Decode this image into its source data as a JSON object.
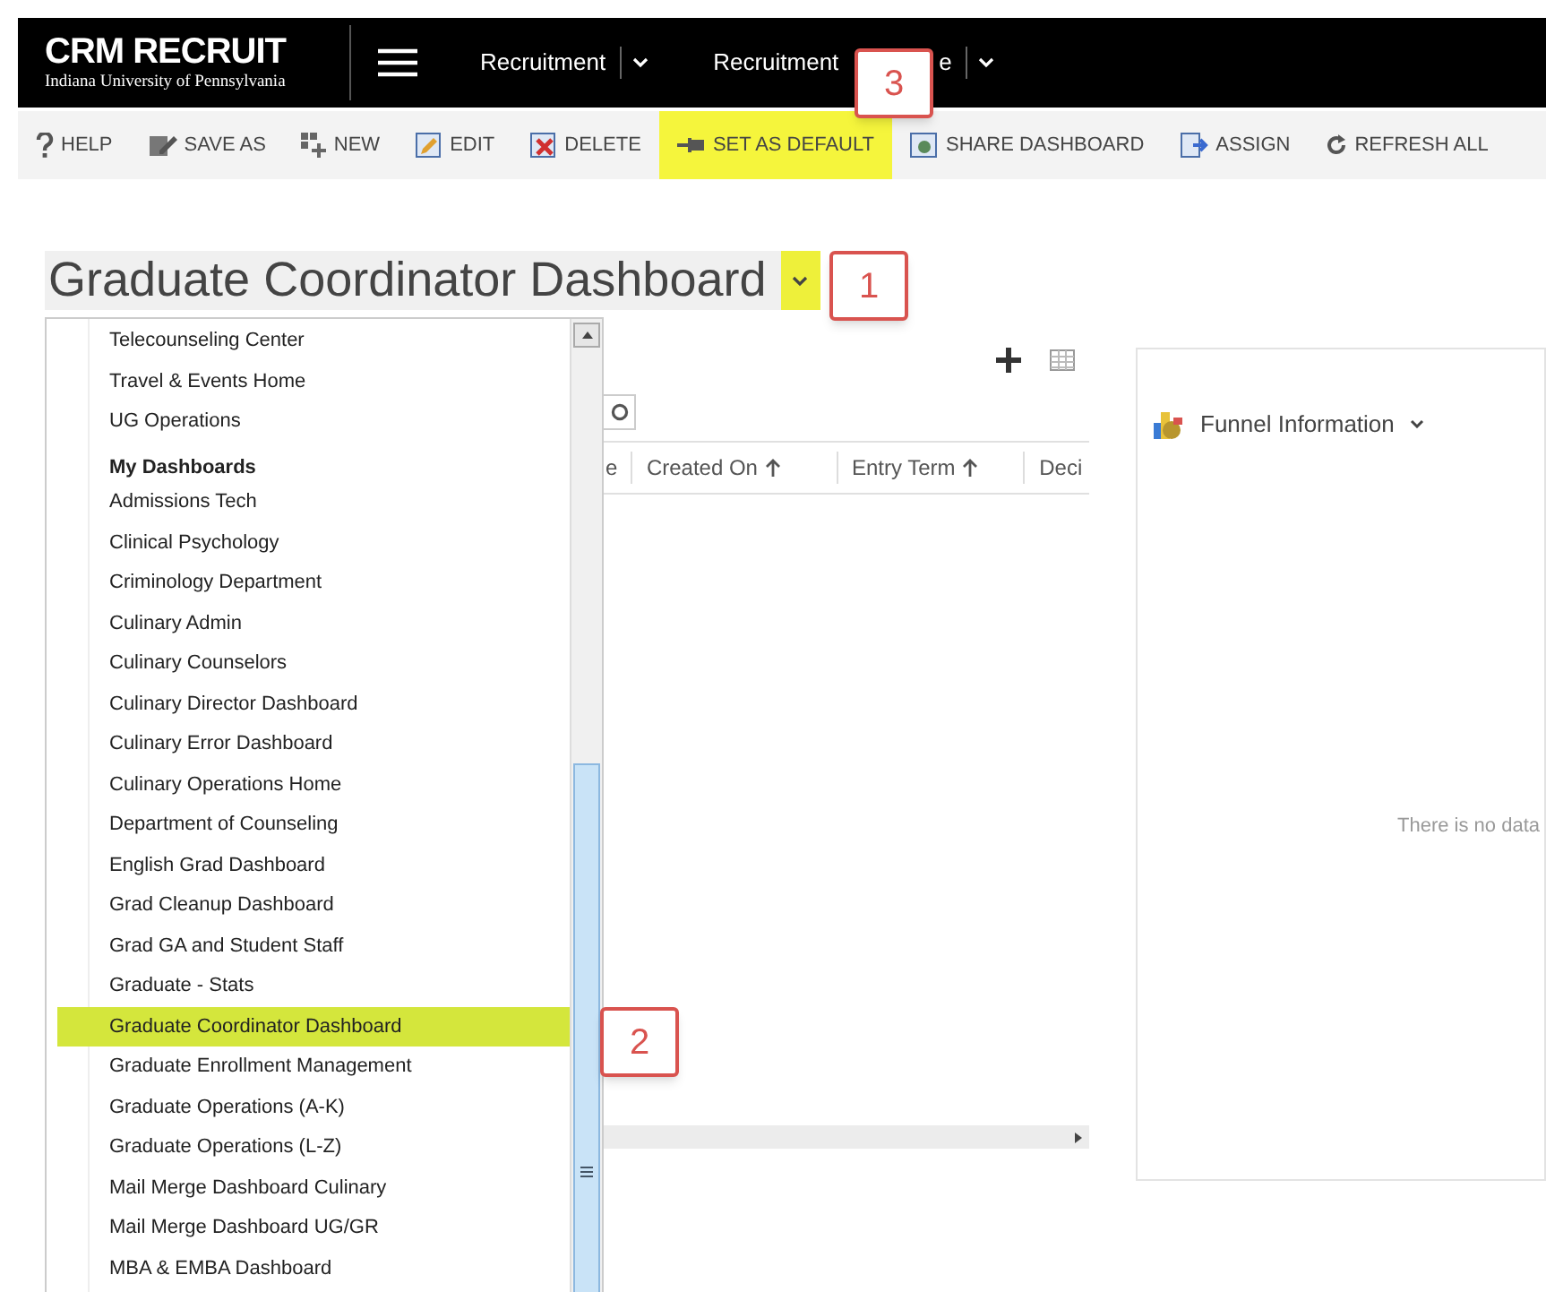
{
  "header": {
    "logo": "CRM RECRUIT",
    "subtitle": "Indiana University of Pennsylvania",
    "nav": [
      {
        "label": "Recruitment"
      },
      {
        "label": "Recruitment",
        "label_end": "e"
      }
    ]
  },
  "toolbar": [
    {
      "label": "HELP",
      "highlighted": false
    },
    {
      "label": "SAVE AS",
      "highlighted": false
    },
    {
      "label": "NEW",
      "highlighted": false
    },
    {
      "label": "EDIT",
      "highlighted": false
    },
    {
      "label": "DELETE",
      "highlighted": false
    },
    {
      "label": "SET AS DEFAULT",
      "highlighted": true
    },
    {
      "label": "SHARE DASHBOARD",
      "highlighted": false
    },
    {
      "label": "ASSIGN",
      "highlighted": false
    },
    {
      "label": "REFRESH ALL",
      "highlighted": false
    }
  ],
  "dashboard_title": "Graduate Coordinator Dashboard",
  "grid": {
    "columns": [
      "e",
      "Created On",
      "Entry Term",
      "Deci"
    ]
  },
  "chart_panel": {
    "title": "Funnel Information",
    "empty_text": "There is no data"
  },
  "dropdown": {
    "items": [
      {
        "kind": "item",
        "label": "Telecounseling Center",
        "selected": false
      },
      {
        "kind": "item",
        "label": "Travel & Events Home",
        "selected": false
      },
      {
        "kind": "item",
        "label": "UG Operations",
        "selected": false
      },
      {
        "kind": "heading",
        "label": "My Dashboards"
      },
      {
        "kind": "item",
        "label": "Admissions Tech",
        "selected": false
      },
      {
        "kind": "item",
        "label": "Clinical Psychology",
        "selected": false
      },
      {
        "kind": "item",
        "label": "Criminology Department",
        "selected": false
      },
      {
        "kind": "item",
        "label": "Culinary Admin",
        "selected": false
      },
      {
        "kind": "item",
        "label": "Culinary Counselors",
        "selected": false
      },
      {
        "kind": "item",
        "label": "Culinary Director Dashboard",
        "selected": false
      },
      {
        "kind": "item",
        "label": "Culinary Error Dashboard",
        "selected": false
      },
      {
        "kind": "item",
        "label": "Culinary Operations Home",
        "selected": false
      },
      {
        "kind": "item",
        "label": "Department of Counseling",
        "selected": false
      },
      {
        "kind": "item",
        "label": "English Grad Dashboard",
        "selected": false
      },
      {
        "kind": "item",
        "label": "Grad Cleanup Dashboard",
        "selected": false
      },
      {
        "kind": "item",
        "label": "Grad GA and Student Staff",
        "selected": false
      },
      {
        "kind": "item",
        "label": "Graduate - Stats",
        "selected": false
      },
      {
        "kind": "item",
        "label": "Graduate Coordinator Dashboard",
        "selected": true
      },
      {
        "kind": "item",
        "label": "Graduate Enrollment Management",
        "selected": false
      },
      {
        "kind": "item",
        "label": "Graduate Operations (A-K)",
        "selected": false
      },
      {
        "kind": "item",
        "label": "Graduate Operations (L-Z)",
        "selected": false
      },
      {
        "kind": "item",
        "label": "Mail Merge Dashboard Culinary",
        "selected": false
      },
      {
        "kind": "item",
        "label": "Mail Merge Dashboard UG/GR",
        "selected": false
      },
      {
        "kind": "item",
        "label": "MBA & EMBA Dashboard",
        "selected": false
      }
    ]
  },
  "callouts": [
    "1",
    "2",
    "3"
  ]
}
